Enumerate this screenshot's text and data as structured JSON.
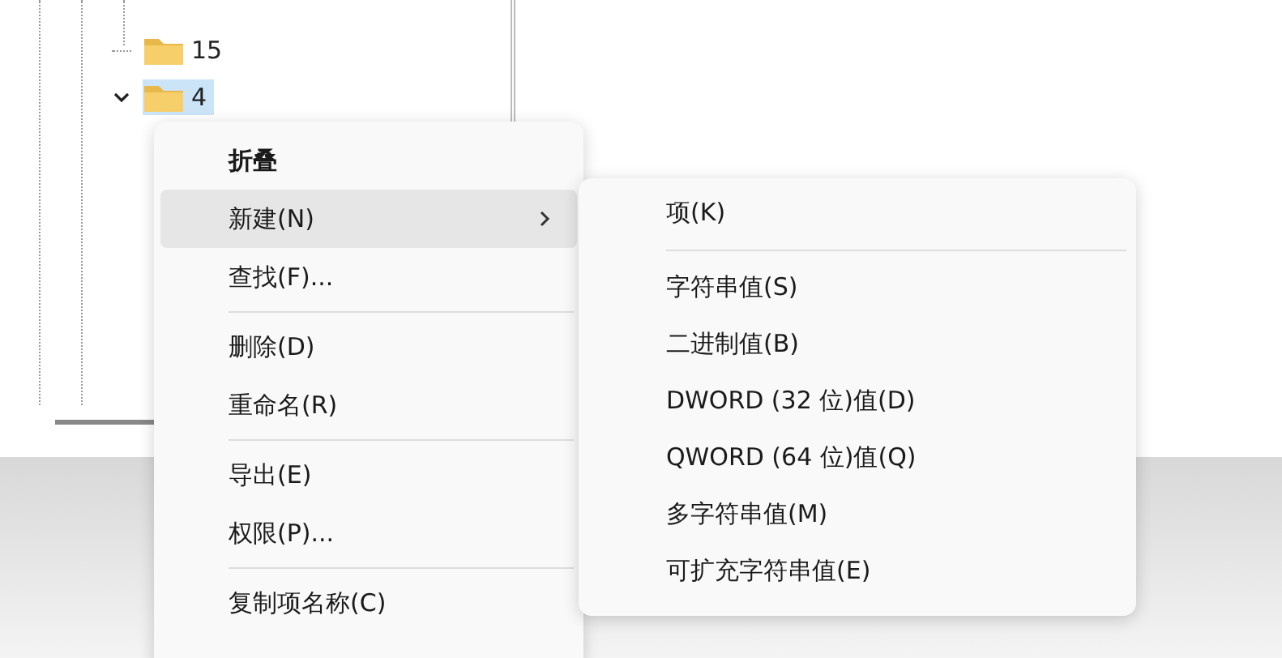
{
  "tree": {
    "items": [
      {
        "label": "15",
        "selected": false,
        "expanded": false
      },
      {
        "label": "4",
        "selected": true,
        "expanded": true
      }
    ]
  },
  "context_menu": {
    "items": [
      {
        "kind": "item",
        "label": "折叠",
        "bold": true,
        "selected": false,
        "submenu": false
      },
      {
        "kind": "item",
        "label": "新建(N)",
        "bold": false,
        "selected": true,
        "submenu": true
      },
      {
        "kind": "item",
        "label": "查找(F)...",
        "bold": false,
        "selected": false,
        "submenu": false
      },
      {
        "kind": "separator"
      },
      {
        "kind": "item",
        "label": "删除(D)",
        "bold": false,
        "selected": false,
        "submenu": false
      },
      {
        "kind": "item",
        "label": "重命名(R)",
        "bold": false,
        "selected": false,
        "submenu": false
      },
      {
        "kind": "separator"
      },
      {
        "kind": "item",
        "label": "导出(E)",
        "bold": false,
        "selected": false,
        "submenu": false
      },
      {
        "kind": "item",
        "label": "权限(P)...",
        "bold": false,
        "selected": false,
        "submenu": false
      },
      {
        "kind": "separator"
      },
      {
        "kind": "item",
        "label": "复制项名称(C)",
        "bold": false,
        "selected": false,
        "submenu": false
      }
    ]
  },
  "submenu": {
    "items": [
      {
        "kind": "item",
        "label": "项(K)"
      },
      {
        "kind": "separator"
      },
      {
        "kind": "item",
        "label": "字符串值(S)"
      },
      {
        "kind": "item",
        "label": "二进制值(B)"
      },
      {
        "kind": "item",
        "label": "DWORD (32 位)值(D)"
      },
      {
        "kind": "item",
        "label": "QWORD (64 位)值(Q)"
      },
      {
        "kind": "item",
        "label": "多字符串值(M)"
      },
      {
        "kind": "item",
        "label": "可扩充字符串值(E)"
      }
    ]
  }
}
